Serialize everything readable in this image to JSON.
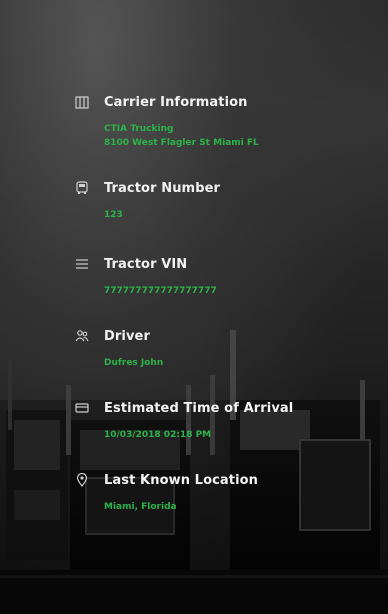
{
  "carrier": {
    "title": "Carrier Information",
    "name": "CTIA Trucking",
    "address": "8100 West Flagler St Miami FL",
    "icon": "building-icon"
  },
  "tractor_number": {
    "title": "Tractor Number",
    "value": "123",
    "icon": "truck-front-icon"
  },
  "tractor_vin": {
    "title": "Tractor VIN",
    "value": "777777777777777777",
    "icon": "list-icon"
  },
  "driver": {
    "title": "Driver",
    "value": "Dufres John",
    "icon": "people-icon"
  },
  "eta": {
    "title": "Estimated Time of Arrival",
    "value": "10/03/2018 02:18 PM",
    "icon": "truck-icon"
  },
  "location": {
    "title": "Last Known Location",
    "value": "Miami, Florida",
    "icon": "location-pin-icon"
  },
  "colors": {
    "accent": "#2bb34a",
    "title": "#f2f2f2"
  }
}
